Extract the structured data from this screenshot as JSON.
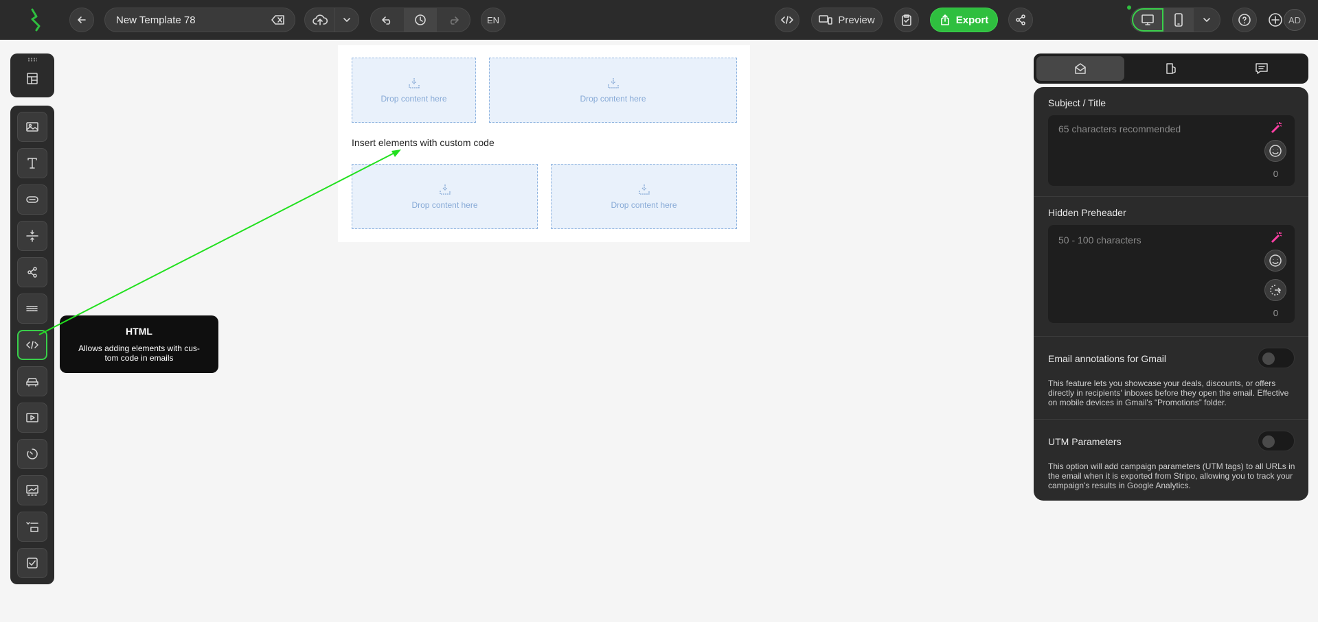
{
  "topbar": {
    "template_name": "New Template 78",
    "language": "EN",
    "preview_label": "Preview",
    "export_label": "Export",
    "avatar_initials": "AD"
  },
  "canvas": {
    "drop_label": "Drop content here",
    "custom_code_text": "Insert elements with custom code"
  },
  "tooltip": {
    "title": "HTML",
    "description": "Allows adding elements with cus-tom code in emails"
  },
  "right_panel": {
    "subject": {
      "label": "Subject / Title",
      "placeholder": "65 characters recommended",
      "count": "0"
    },
    "preheader": {
      "label": "Hidden Preheader",
      "placeholder": "50 - 100 characters",
      "count": "0"
    },
    "gmail": {
      "label": "Email annotations for Gmail",
      "description": "This feature lets you showcase your deals, discounts, or offers directly in recipients' inboxes before they open the email. Effective on mobile devices in Gmail's “Promotions” folder."
    },
    "utm": {
      "label": "UTM Parameters",
      "description": "This option will add campaign parameters (UTM tags) to all URLs in the email when it is exported from Stripo, allowing you to track your campaign's results in Google Analytics."
    }
  },
  "colors": {
    "accent": "#2fbf3f",
    "annotation_arrow": "#22e01f",
    "magic_wand": "#ff3fa4"
  }
}
